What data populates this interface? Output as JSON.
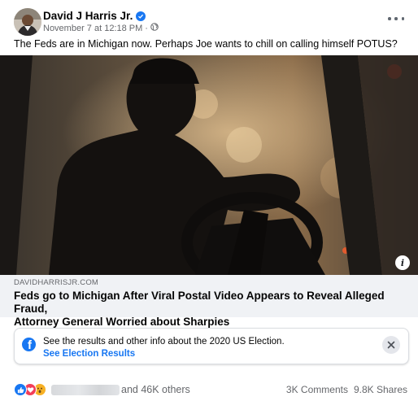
{
  "post": {
    "author": "David J Harris Jr.",
    "timestamp": "November 7 at 12:18 PM",
    "separator": "·",
    "text": "The Feds are in Michigan now. Perhaps Joe wants to chill on calling himself POTUS?"
  },
  "link": {
    "domain": "DAVIDHARRISJR.COM",
    "title_line1": "Feds go to Michigan After Viral Postal Video Appears to Reveal Alleged Fraud,",
    "title_line2": "Attorney General Worried about Sharpies",
    "info_glyph": "i"
  },
  "election_notice": {
    "text": "See the results and other info about the 2020 US Election.",
    "link_label": "See Election Results",
    "logo_glyph": "f"
  },
  "engagement": {
    "reactions": [
      "like",
      "love",
      "wow"
    ],
    "others_label": "and 46K others",
    "comments_label": "3K Comments",
    "shares_label": "9.8K Shares"
  },
  "colors": {
    "accent": "#1877f2",
    "secondary_text": "#65676b",
    "love": "#f33e58",
    "wow": "#f7b125"
  }
}
